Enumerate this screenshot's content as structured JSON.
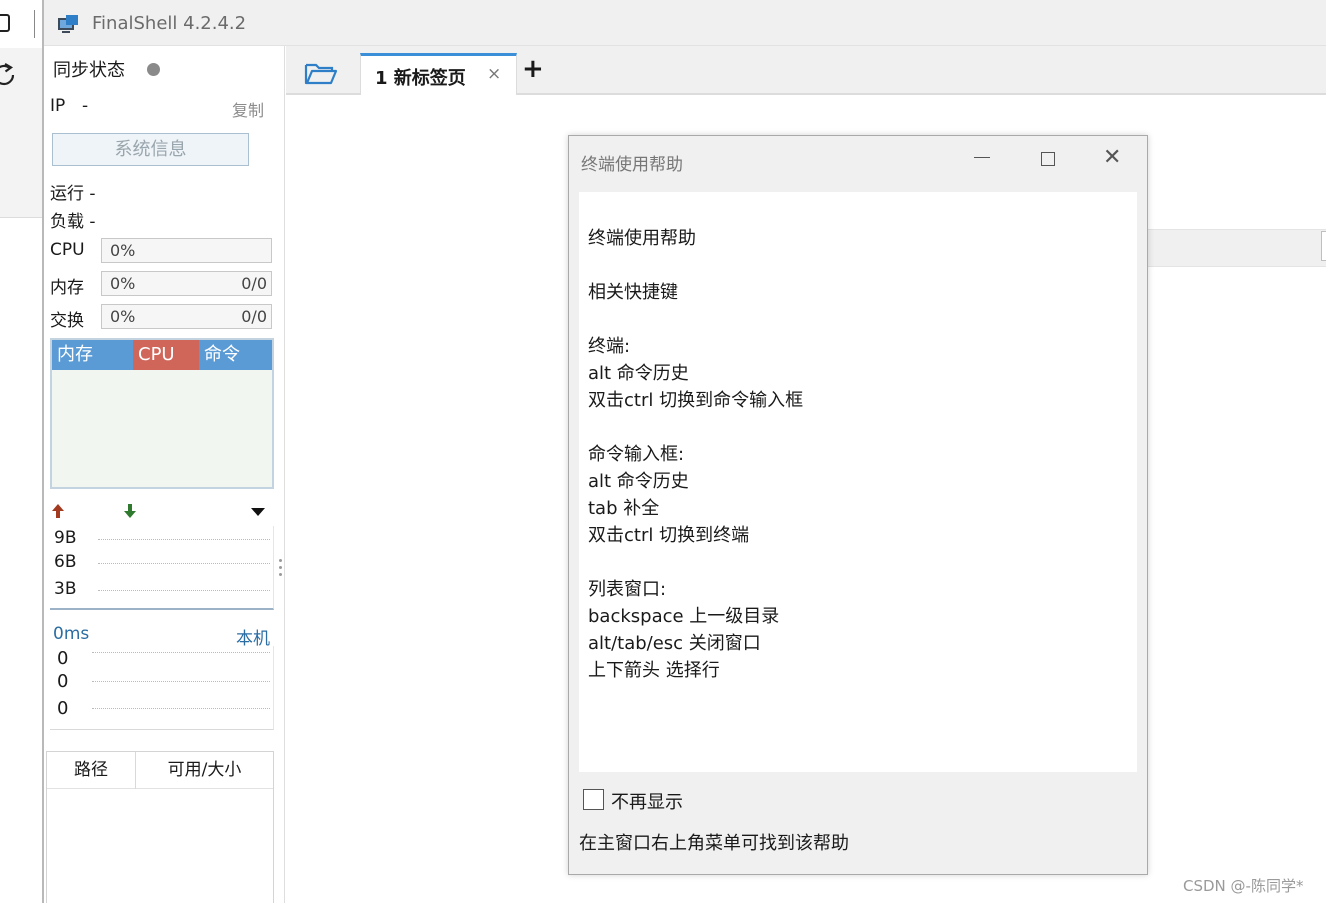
{
  "window": {
    "title": "FinalShell 4.2.4.2"
  },
  "sidebar": {
    "sync_label": "同步状态",
    "ip_label": "IP",
    "ip_value": "-",
    "copy_label": "复制",
    "sysinfo_button": "系统信息",
    "run_label": "运行 -",
    "load_label": "负载 -",
    "cpu": {
      "label": "CPU",
      "percent": "0%"
    },
    "memory": {
      "label": "内存",
      "percent": "0%",
      "ratio": "0/0"
    },
    "swap": {
      "label": "交换",
      "percent": "0%",
      "ratio": "0/0"
    },
    "process_table": {
      "columns": [
        "内存",
        "CPU",
        "命令"
      ],
      "header_colors": {
        "memory": "#5a9bd6",
        "cpu": "#d0665a",
        "command": "#5a9bd6"
      }
    },
    "network": {
      "upload_icon": "arrow-up-icon",
      "download_icon": "arrow-down-icon",
      "up_color": "#a33a1f",
      "down_color": "#2f7a2f",
      "y_labels": [
        "9B",
        "6B",
        "3B"
      ]
    },
    "ping": {
      "latency": "0ms",
      "target": "本机",
      "values": [
        "0",
        "0",
        "0"
      ]
    },
    "disk_table": {
      "columns": [
        "路径",
        "可用/大小"
      ]
    }
  },
  "tabs": {
    "items": [
      {
        "label": "1 新标签页",
        "active": true
      }
    ],
    "close_glyph": "×",
    "add_glyph": "+",
    "accent_color": "#3b8fd9"
  },
  "dialog": {
    "title": "终端使用帮助",
    "help_lines": [
      "终端使用帮助",
      "相关快捷键",
      "终端:",
      "alt 命令历史",
      "双击ctrl 切换到命令输入框",
      "命令输入框:",
      "alt 命令历史",
      "tab 补全",
      "双击ctrl 切换到终端",
      "列表窗口:",
      "backspace 上一级目录",
      "alt/tab/esc 关闭窗口",
      "上下箭头 选择行"
    ],
    "dont_show_again": "不再显示",
    "dont_show_checked": false,
    "footer_note": "在主窗口右上角菜单可找到该帮助"
  },
  "watermark": "CSDN @-陈同学*"
}
